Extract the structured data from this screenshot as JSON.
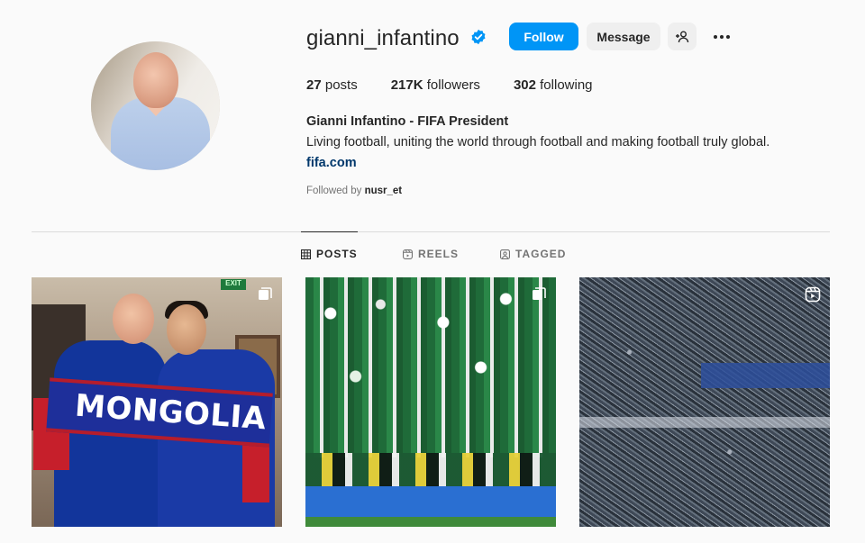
{
  "profile": {
    "username": "gianni_infantino",
    "verified": true,
    "follow_label": "Follow",
    "message_label": "Message",
    "posts_count": "27",
    "posts_label": "posts",
    "followers_count": "217K",
    "followers_label": "followers",
    "following_count": "302",
    "following_label": "following",
    "full_name": "Gianni Infantino - FIFA President",
    "bio": "Living football, uniting the world through football and making football truly global.",
    "link": "fifa.com",
    "followed_by_prefix": "Followed by",
    "followed_by_user": "nusr_et"
  },
  "tabs": [
    {
      "label": "POSTS",
      "icon": "grid-icon",
      "active": true
    },
    {
      "label": "REELS",
      "icon": "reels-icon",
      "active": false
    },
    {
      "label": "TAGGED",
      "icon": "tagged-icon",
      "active": false
    }
  ],
  "posts": [
    {
      "scarf_text": "MONGOLIA",
      "badge": "carousel-icon",
      "exit_sign": "EXIT"
    },
    {
      "badge": "carousel-icon"
    },
    {
      "badge": "reel-icon"
    }
  ],
  "colors": {
    "accent": "#0095f6",
    "verified": "#0095f6",
    "link": "#00376b",
    "muted": "#737373"
  }
}
